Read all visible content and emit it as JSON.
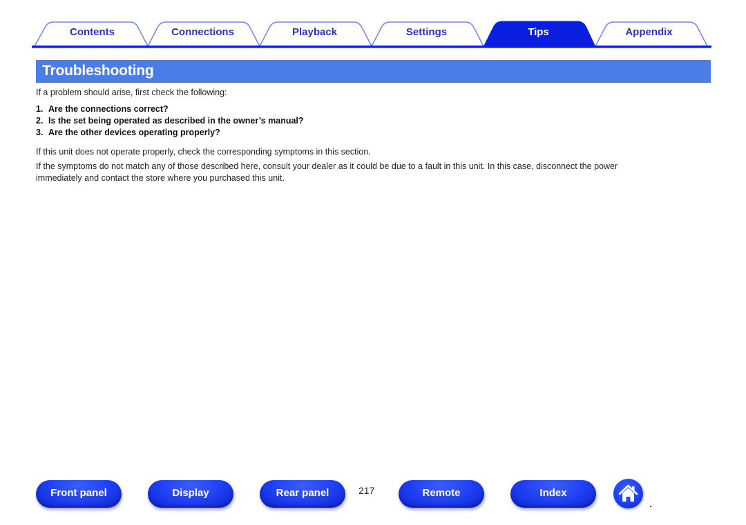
{
  "tabs": [
    {
      "label": "Contents",
      "active": false
    },
    {
      "label": "Connections",
      "active": false
    },
    {
      "label": "Playback",
      "active": false
    },
    {
      "label": "Settings",
      "active": false
    },
    {
      "label": "Tips",
      "active": true
    },
    {
      "label": "Appendix",
      "active": false
    }
  ],
  "page": {
    "title": "Troubleshooting",
    "intro": "If a problem should arise, first check the following:",
    "checklist": [
      {
        "num": "1.",
        "text": "Are the connections correct?"
      },
      {
        "num": "2.",
        "text": "Is the set being operated as described in the owner’s manual?"
      },
      {
        "num": "3.",
        "text": "Are the other devices operating properly?"
      }
    ],
    "para1": "If this unit does not operate properly, check the corresponding symptoms in this section.",
    "para2_line1": "If the symptoms do not match any of those described here, consult your dealer as it could be due to a fault in this unit. In this case, disconnect the power",
    "para2_line2": "immediately and contact the store where you purchased this unit."
  },
  "footer": {
    "buttons": [
      {
        "label": "Front panel"
      },
      {
        "label": "Display"
      },
      {
        "label": "Rear panel"
      },
      {
        "label": "Remote"
      },
      {
        "label": "Index"
      }
    ],
    "page_number": "217",
    "home_icon": "home-icon"
  },
  "colors": {
    "accent": "#0a1ee0",
    "title_bar": "#4a7de8",
    "tab_text": "#2a2fcf"
  }
}
